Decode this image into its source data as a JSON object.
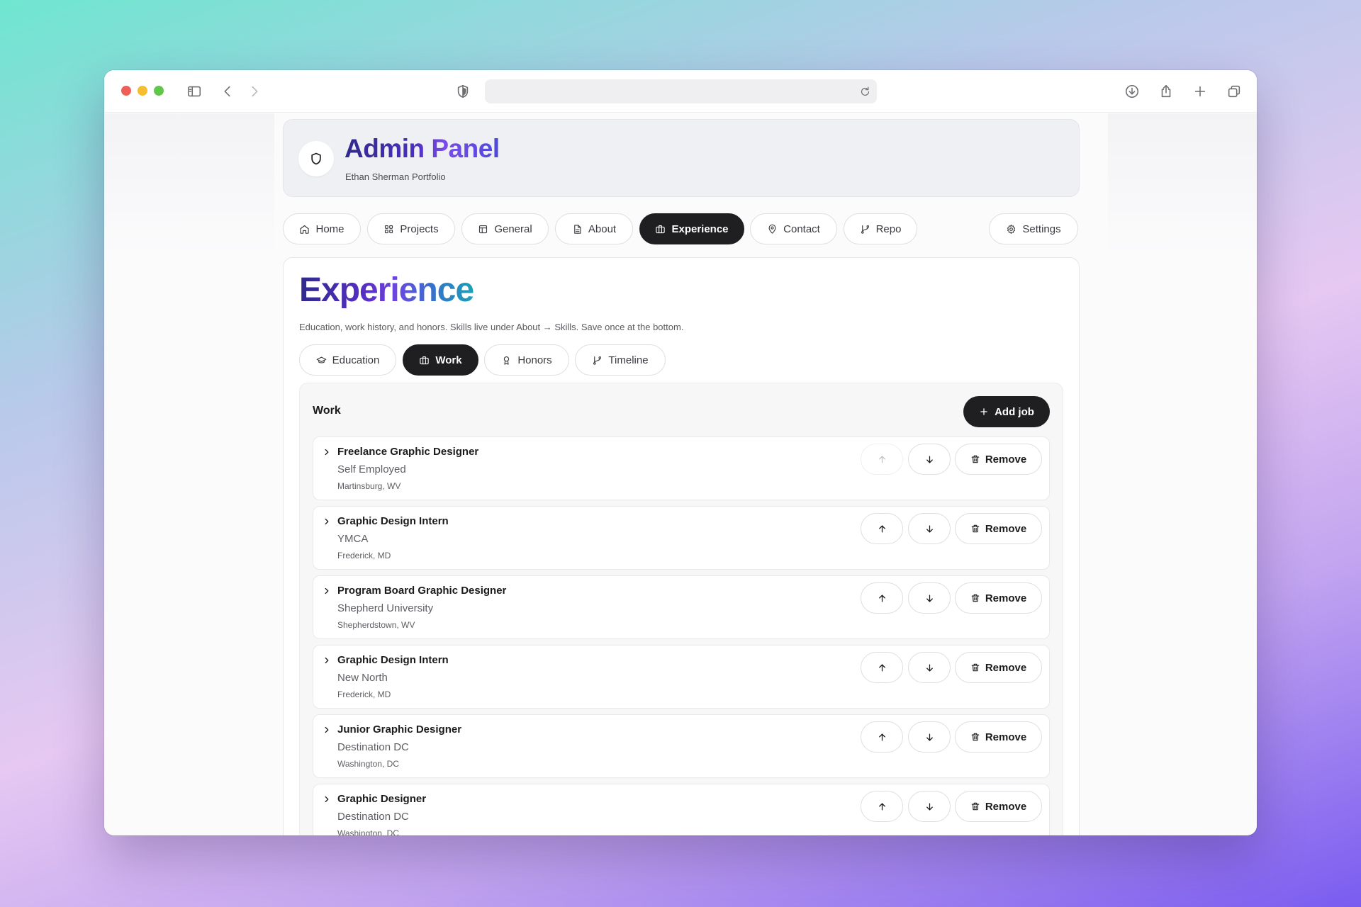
{
  "browser": {
    "icons": [
      "sidebar-icon",
      "back-icon",
      "forward-icon",
      "shield-privacy-icon",
      "reload-icon",
      "download-icon",
      "share-icon",
      "new-tab-icon",
      "tabs-overview-icon"
    ],
    "address_value": ""
  },
  "header": {
    "title": "Admin Panel",
    "subtitle": "Ethan Sherman Portfolio",
    "icon": "shield-icon"
  },
  "nav": {
    "items": [
      {
        "label": "Home",
        "icon": "home-icon"
      },
      {
        "label": "Projects",
        "icon": "grid-icon"
      },
      {
        "label": "General",
        "icon": "layout-icon"
      },
      {
        "label": "About",
        "icon": "document-icon"
      },
      {
        "label": "Experience",
        "icon": "briefcase-icon",
        "active": true
      },
      {
        "label": "Contact",
        "icon": "map-pin-icon"
      },
      {
        "label": "Repo",
        "icon": "git-branch-icon"
      }
    ],
    "settings_label": "Settings"
  },
  "section": {
    "title": "Experience",
    "description": "Education, work history, and honors. Skills live under About → Skills. Save once at the bottom.",
    "subtabs": [
      {
        "label": "Education",
        "icon": "graduation-cap-icon"
      },
      {
        "label": "Work",
        "icon": "briefcase-icon",
        "active": true
      },
      {
        "label": "Honors",
        "icon": "award-icon"
      },
      {
        "label": "Timeline",
        "icon": "git-branch-icon"
      }
    ]
  },
  "work": {
    "label": "Work",
    "add_label": "Add job",
    "remove_label": "Remove",
    "jobs": [
      {
        "title": "Freelance Graphic Designer",
        "company": "Self Employed",
        "location": "Martinsburg, WV"
      },
      {
        "title": "Graphic Design Intern",
        "company": "YMCA",
        "location": "Frederick, MD"
      },
      {
        "title": "Program Board Graphic Designer",
        "company": "Shepherd University",
        "location": "Shepherdstown, WV"
      },
      {
        "title": "Graphic Design Intern",
        "company": "New North",
        "location": "Frederick, MD"
      },
      {
        "title": "Junior Graphic Designer",
        "company": "Destination DC",
        "location": "Washington, DC"
      },
      {
        "title": "Graphic Designer",
        "company": "Destination DC",
        "location": "Washington, DC"
      }
    ]
  },
  "colors": {
    "accent_dark": "#1f1f22",
    "title_gradient_start": "#2f2a8a",
    "title_gradient_end": "#1ca0b8"
  }
}
